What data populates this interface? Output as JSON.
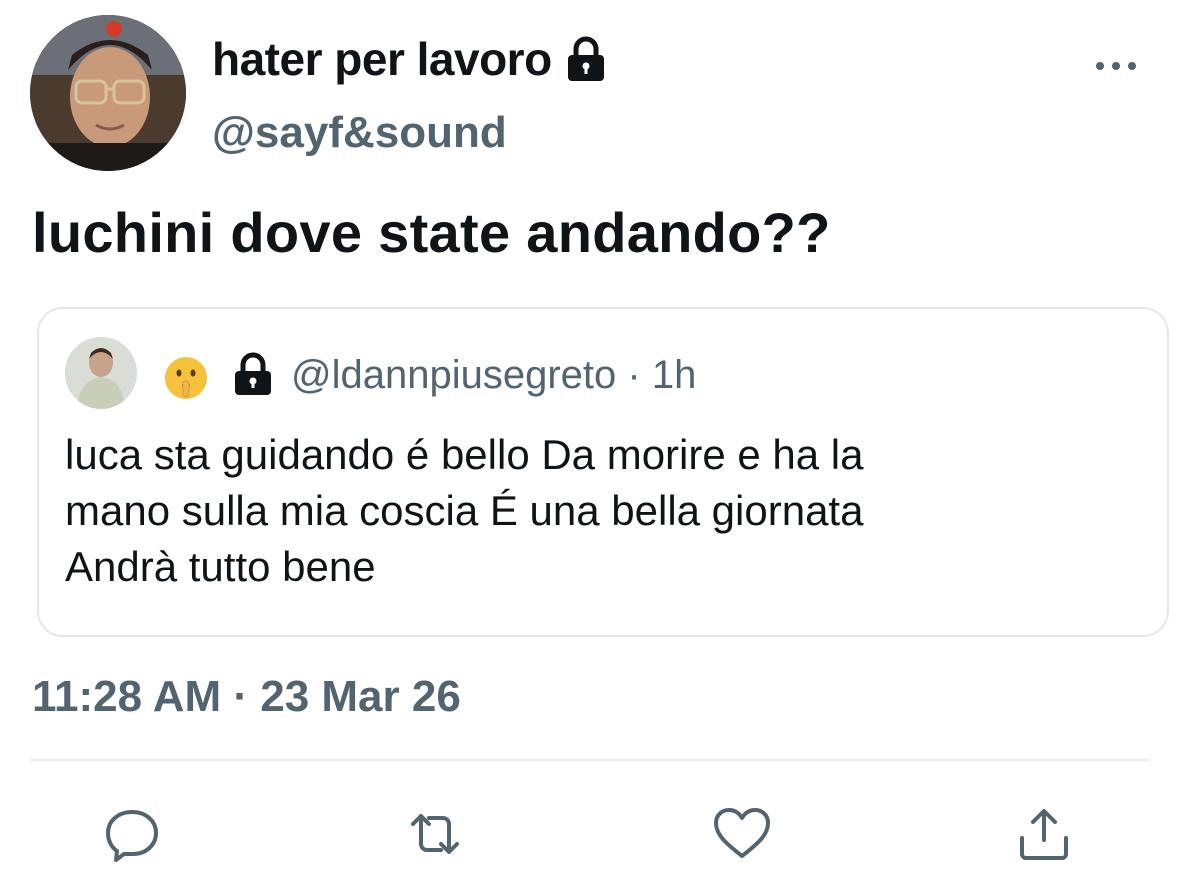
{
  "author": {
    "display_name": "hater per lavoro",
    "handle": "@sayf&sound",
    "avatar_icon": "user-avatar",
    "protected_icon": "lock-icon"
  },
  "tweet": {
    "text": "luchini dove state andando??",
    "timestamp": "11:28 AM · 23 Mar 26"
  },
  "quoted_tweet": {
    "emoji": "🤫",
    "protected_icon": "lock-icon",
    "handle": "@ldannpiusegreto",
    "separator": "·",
    "age": "1h",
    "lines": [
      "luca sta guidando é bello Da morire e ha la",
      "mano sulla mia coscia É una bella giornata",
      "Andrà tutto bene"
    ]
  },
  "actions": [
    {
      "name": "reply",
      "icon": "reply-icon"
    },
    {
      "name": "retweet",
      "icon": "retweet-icon"
    },
    {
      "name": "like",
      "icon": "heart-icon"
    },
    {
      "name": "share",
      "icon": "share-icon"
    }
  ],
  "colors": {
    "text": "#0f1419",
    "secondary": "#536471",
    "border": "#e1e8ed"
  }
}
